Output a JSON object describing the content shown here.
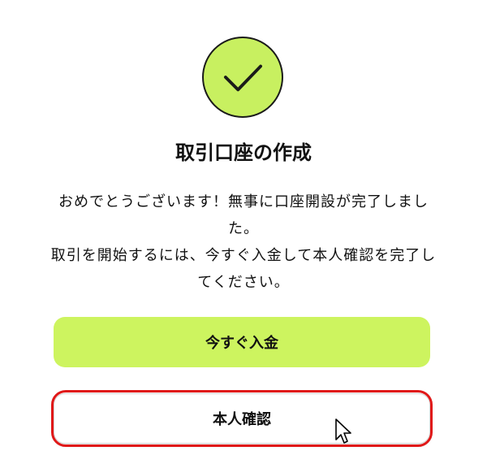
{
  "success": {
    "icon": "check-icon",
    "accent_color": "#c8f060"
  },
  "title": "取引口座の作成",
  "message": {
    "line1": "おめでとうございます！無事に口座開設が完了しました。",
    "line2": "取引を開始するには、今すぐ入金して本人確認を完了してください。"
  },
  "buttons": {
    "deposit_label": "今すぐ入金",
    "verify_label": "本人確認"
  },
  "colors": {
    "primary_button": "#cdf45f",
    "highlight": "#e01818"
  }
}
